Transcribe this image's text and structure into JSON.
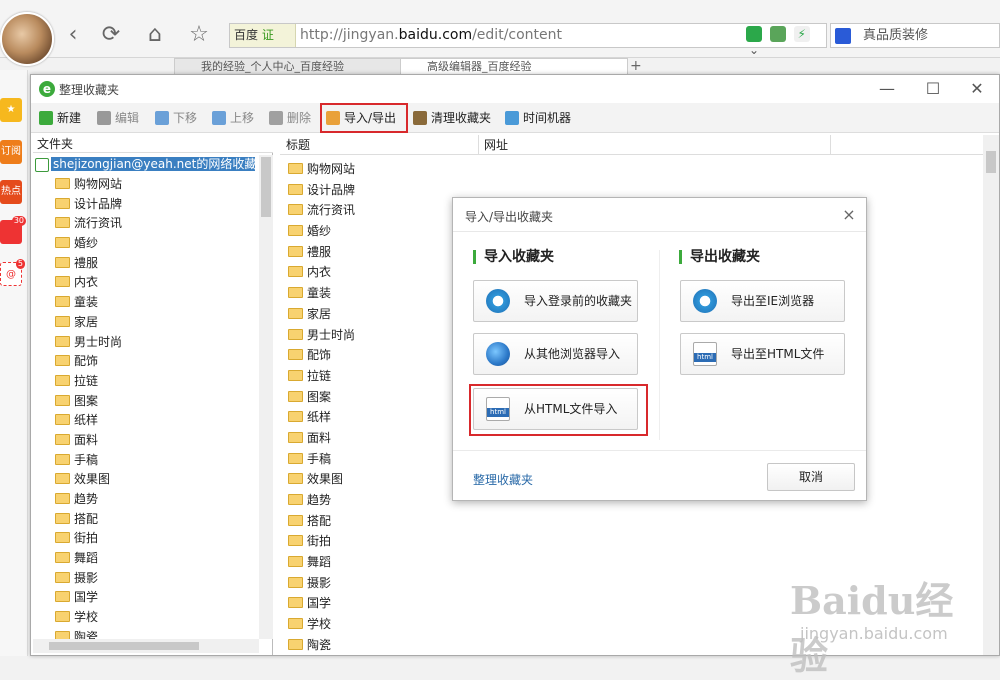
{
  "browser": {
    "address_badge": "百度",
    "address_badge_cert": "证",
    "address_url_prefix": "http://jingyan.",
    "address_url_domain": "baidu.com",
    "address_url_path": "/edit/content",
    "search_text": "真品质装修",
    "tabs": [
      {
        "label": "我的经验_个人中心_百度经验"
      },
      {
        "label": "高级编辑器_百度经验"
      }
    ],
    "new_tab_label": "+"
  },
  "sidebar": {
    "badge_weibo": "30",
    "badge_mail": "5",
    "item_labels": [
      "订阅",
      "热点"
    ]
  },
  "window": {
    "title": "整理收藏夹",
    "toolbar": {
      "new": "新建",
      "edit": "编辑",
      "move_down": "下移",
      "move_up": "上移",
      "delete": "删除",
      "import_export": "导入/导出",
      "cleanup": "清理收藏夹",
      "time_machine": "时间机器"
    },
    "folder_pane": {
      "header": "文件夹",
      "root": "shejizongjian@yeah.net的网络收藏夹",
      "folders": [
        "购物网站",
        "设计品牌",
        "流行资讯",
        "婚纱",
        "禮服",
        "内衣",
        "童装",
        "家居",
        "男士时尚",
        "配饰",
        "拉链",
        "图案",
        "纸样",
        "面料",
        "手稿",
        "效果图",
        "趋势",
        "搭配",
        "街拍",
        "舞蹈",
        "摄影",
        "国学",
        "学校",
        "陶瓷"
      ]
    },
    "list_pane": {
      "col_title": "标题",
      "col_url": "网址",
      "items": [
        "购物网站",
        "设计品牌",
        "流行资讯",
        "婚纱",
        "禮服",
        "内衣",
        "童装",
        "家居",
        "男士时尚",
        "配饰",
        "拉链",
        "图案",
        "纸样",
        "面料",
        "手稿",
        "效果图",
        "趋势",
        "搭配",
        "街拍",
        "舞蹈",
        "摄影",
        "国学",
        "学校",
        "陶瓷"
      ]
    }
  },
  "dialog": {
    "title": "导入/导出收藏夹",
    "import_header": "导入收藏夹",
    "export_header": "导出收藏夹",
    "import_login": "导入登录前的收藏夹",
    "import_other_browser": "从其他浏览器导入",
    "import_html": "从HTML文件导入",
    "export_ie": "导出至IE浏览器",
    "export_html": "导出至HTML文件",
    "organize_link": "整理收藏夹",
    "cancel": "取消"
  },
  "watermark": {
    "main": "Baidu经验",
    "sub": "jingyan.baidu.com"
  },
  "colors": {
    "highlight_red": "#d8292c",
    "accent_green": "#3caa3c",
    "selection_blue": "#3a7fc1",
    "link_blue": "#2a6aa8"
  }
}
